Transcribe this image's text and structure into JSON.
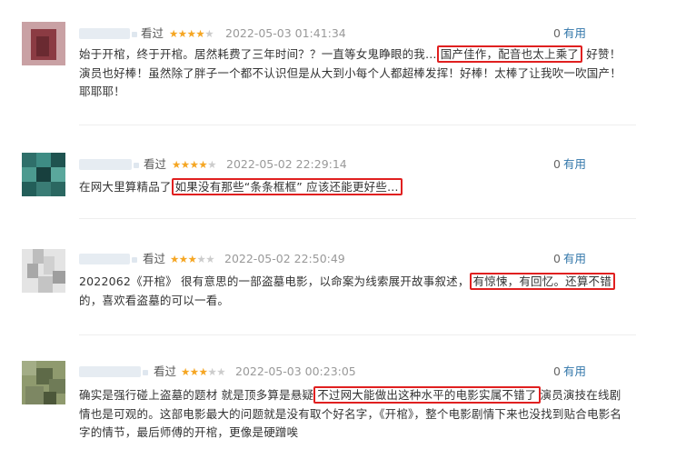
{
  "reviews": [
    {
      "watched_label": "看过",
      "rating": 4,
      "date": "2022-05-03 01:41:34",
      "useful_count": "0",
      "useful_label": "有用",
      "text_before": "始于开棺，终于开棺。居然耗费了三年时间？？一直等女鬼睁眼的我…",
      "highlight": "国产佳作，配音也太上乘了",
      "text_after": "好赞！演员也好棒！虽然除了胖子一个都不认识但是从大到小每个人都超棒发挥！好棒！太棒了让我吹一吹国产！耶耶耶！"
    },
    {
      "watched_label": "看过",
      "rating": 4,
      "date": "2022-05-02 22:29:14",
      "useful_count": "0",
      "useful_label": "有用",
      "text_before": "在网大里算精品了",
      "highlight": "如果没有那些“条条框框” 应该还能更好些…",
      "text_after": ""
    },
    {
      "watched_label": "看过",
      "rating": 3,
      "date": "2022-05-02 22:50:49",
      "useful_count": "0",
      "useful_label": "有用",
      "text_before": "2022062《开棺》 很有意思的一部盗墓电影，以命案为线索展开故事叙述，",
      "highlight": "有惊悚，有回忆。还算不错",
      "text_after": "的，喜欢看盗墓的可以一看。"
    },
    {
      "watched_label": "看过",
      "rating": 3,
      "date": "2022-05-03 00:23:05",
      "useful_count": "0",
      "useful_label": "有用",
      "text_before": "确实是强行碰上盗墓的题材 就是顶多算是悬疑",
      "highlight": "不过网大能做出这种水平的电影实属不错了",
      "text_after": "演员演技在线剧情也是可观的。这部电影最大的问题就是没有取个好名字，《开棺》，整个电影剧情下来也没找到贴合电影名字的情节，最后师傅的开棺，更像是硬蹭唉"
    }
  ],
  "colors": {
    "highlight_box": "#e02020",
    "star": "#f5a623",
    "link": "#3377aa",
    "date": "#999999"
  }
}
